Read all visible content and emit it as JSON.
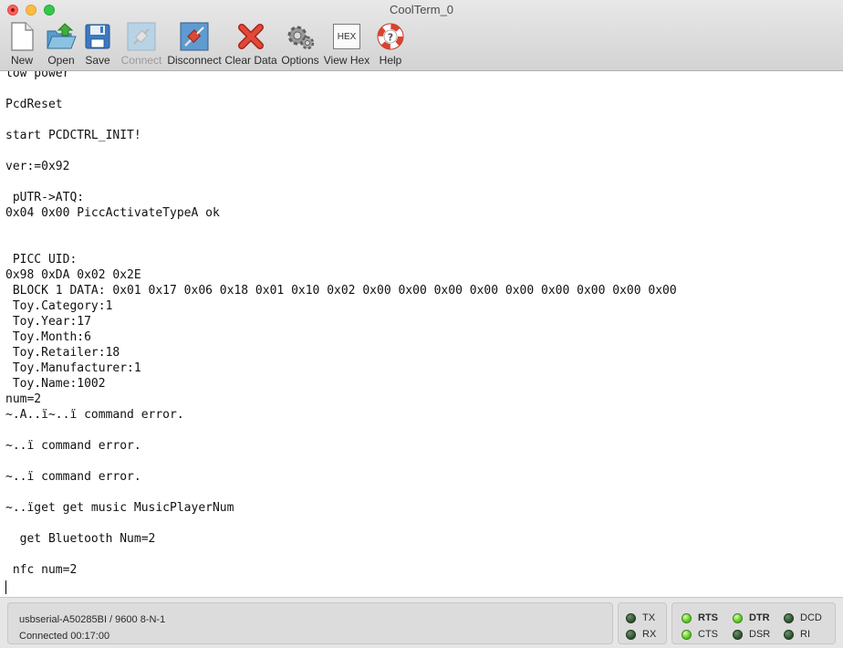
{
  "window": {
    "title": "CoolTerm_0"
  },
  "toolbar": {
    "buttons": [
      {
        "label": "New",
        "icon": "new-document-icon",
        "enabled": true
      },
      {
        "label": "Open",
        "icon": "open-folder-icon",
        "enabled": true
      },
      {
        "label": "Save",
        "icon": "save-floppy-icon",
        "enabled": true
      },
      {
        "label": "Connect",
        "icon": "connect-plug-icon",
        "enabled": false
      },
      {
        "label": "Disconnect",
        "icon": "disconnect-plug-icon",
        "enabled": true
      },
      {
        "label": "Clear Data",
        "icon": "clear-x-icon",
        "enabled": true
      },
      {
        "label": "Options",
        "icon": "options-gear-icon",
        "enabled": true
      },
      {
        "label": "View Hex",
        "icon": "hex-icon",
        "enabled": true,
        "glyph": "HEX"
      },
      {
        "label": "Help",
        "icon": "help-lifebuoy-icon",
        "enabled": true
      }
    ]
  },
  "terminal": {
    "lines": [
      "low power",
      "",
      "PcdReset",
      "",
      "start PCDCTRL_INIT!",
      "",
      "ver:=0x92",
      "",
      " pUTR->ATQ:",
      "0x04 0x00 PiccActivateTypeA ok",
      "",
      "",
      " PICC UID:",
      "0x98 0xDA 0x02 0x2E",
      " BLOCK 1 DATA: 0x01 0x17 0x06 0x18 0x01 0x10 0x02 0x00 0x00 0x00 0x00 0x00 0x00 0x00 0x00 0x00",
      " Toy.Category:1",
      " Toy.Year:17",
      " Toy.Month:6",
      " Toy.Retailer:18",
      " Toy.Manufacturer:1",
      " Toy.Name:1002",
      "num=2",
      "~.A..ï~..ï command error.",
      "",
      "~..ï command error.",
      "",
      "~..ï command error.",
      "",
      "~..ïget get music MusicPlayerNum",
      "",
      "  get Bluetooth Num=2",
      "",
      " nfc num=2",
      ""
    ]
  },
  "status": {
    "port": "usbserial-A50285BI / 9600 8-N-1",
    "connection": "Connected 00:17:00",
    "leds": {
      "tx": {
        "label": "TX",
        "on": false
      },
      "rx": {
        "label": "RX",
        "on": false
      },
      "rts": {
        "label": "RTS",
        "on": true
      },
      "cts": {
        "label": "CTS",
        "on": true
      },
      "dtr": {
        "label": "DTR",
        "on": true
      },
      "dsr": {
        "label": "DSR",
        "on": false
      },
      "dcd": {
        "label": "DCD",
        "on": false
      },
      "ri": {
        "label": "RI",
        "on": false
      }
    },
    "colors": {
      "led_on": "#57c21c",
      "led_off": "#2e4d2e"
    }
  }
}
